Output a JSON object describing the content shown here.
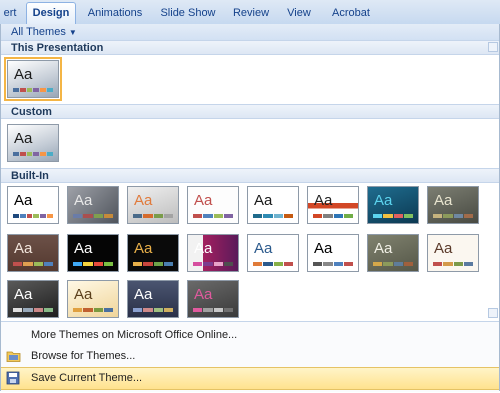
{
  "ribbon": {
    "tabs": [
      {
        "label": "ert"
      },
      {
        "label": "Design"
      },
      {
        "label": "Animations"
      },
      {
        "label": "Slide Show"
      },
      {
        "label": "Review"
      },
      {
        "label": "View"
      },
      {
        "label": "Acrobat"
      }
    ],
    "active_tab": "Design"
  },
  "gallery": {
    "filter_label": "All Themes",
    "sections": {
      "this_presentation": "This Presentation",
      "custom": "Custom",
      "built_in": "Built-In"
    },
    "sample_text": "Aa"
  },
  "menu": {
    "more_themes": "More Themes on Microsoft Office Online...",
    "browse_themes": "Browse for Themes...",
    "save_theme": "Save Current Theme..."
  },
  "colors": {
    "accent_selected": "#f4b545",
    "menu_hover": "#ffe28e"
  }
}
